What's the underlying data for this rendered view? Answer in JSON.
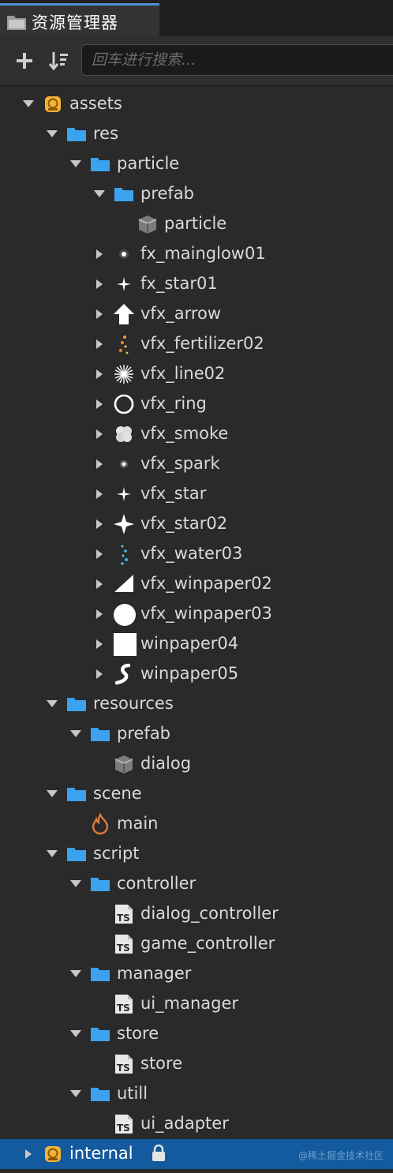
{
  "panel": {
    "title": "资源管理器"
  },
  "toolbar": {
    "search_placeholder": "回车进行搜索..."
  },
  "tree": [
    {
      "depth": 0,
      "label": "assets",
      "icon": "db-icon",
      "expanded": true
    },
    {
      "depth": 1,
      "label": "res",
      "icon": "folder-icon",
      "expanded": true
    },
    {
      "depth": 2,
      "label": "particle",
      "icon": "folder-icon",
      "expanded": true
    },
    {
      "depth": 3,
      "label": "prefab",
      "icon": "folder-icon",
      "expanded": true
    },
    {
      "depth": 4,
      "label": "particle",
      "icon": "prefab-icon"
    },
    {
      "depth": 3,
      "label": "fx_mainglow01",
      "icon": "glow-small-icon",
      "expanded": false
    },
    {
      "depth": 3,
      "label": "fx_star01",
      "icon": "star-small-icon",
      "expanded": false
    },
    {
      "depth": 3,
      "label": "vfx_arrow",
      "icon": "arrow-up-icon",
      "expanded": false
    },
    {
      "depth": 3,
      "label": "vfx_fertilizer02",
      "icon": "fertilizer-icon",
      "expanded": false
    },
    {
      "depth": 3,
      "label": "vfx_line02",
      "icon": "burst-icon",
      "expanded": false
    },
    {
      "depth": 3,
      "label": "vfx_ring",
      "icon": "ring-icon",
      "expanded": false
    },
    {
      "depth": 3,
      "label": "vfx_smoke",
      "icon": "smoke-icon",
      "expanded": false
    },
    {
      "depth": 3,
      "label": "vfx_spark",
      "icon": "spark-icon",
      "expanded": false
    },
    {
      "depth": 3,
      "label": "vfx_star",
      "icon": "star-small-icon",
      "expanded": false
    },
    {
      "depth": 3,
      "label": "vfx_star02",
      "icon": "star-large-icon",
      "expanded": false
    },
    {
      "depth": 3,
      "label": "vfx_water03",
      "icon": "water-icon",
      "expanded": false
    },
    {
      "depth": 3,
      "label": "vfx_winpaper02",
      "icon": "triangle-icon",
      "expanded": false
    },
    {
      "depth": 3,
      "label": "vfx_winpaper03",
      "icon": "circle-icon",
      "expanded": false
    },
    {
      "depth": 3,
      "label": "winpaper04",
      "icon": "square-icon",
      "expanded": false
    },
    {
      "depth": 3,
      "label": "winpaper05",
      "icon": "curl-icon",
      "expanded": false
    },
    {
      "depth": 1,
      "label": "resources",
      "icon": "folder-icon",
      "expanded": true
    },
    {
      "depth": 2,
      "label": "prefab",
      "icon": "folder-icon",
      "expanded": true
    },
    {
      "depth": 3,
      "label": "dialog",
      "icon": "prefab-icon"
    },
    {
      "depth": 1,
      "label": "scene",
      "icon": "folder-icon",
      "expanded": true
    },
    {
      "depth": 2,
      "label": "main",
      "icon": "scene-icon"
    },
    {
      "depth": 1,
      "label": "script",
      "icon": "folder-icon",
      "expanded": true
    },
    {
      "depth": 2,
      "label": "controller",
      "icon": "folder-icon",
      "expanded": true
    },
    {
      "depth": 3,
      "label": "dialog_controller",
      "icon": "ts-icon"
    },
    {
      "depth": 3,
      "label": "game_controller",
      "icon": "ts-icon"
    },
    {
      "depth": 2,
      "label": "manager",
      "icon": "folder-icon",
      "expanded": true
    },
    {
      "depth": 3,
      "label": "ui_manager",
      "icon": "ts-icon"
    },
    {
      "depth": 2,
      "label": "store",
      "icon": "folder-icon",
      "expanded": true
    },
    {
      "depth": 3,
      "label": "store",
      "icon": "ts-icon"
    },
    {
      "depth": 2,
      "label": "utill",
      "icon": "folder-icon",
      "expanded": true
    },
    {
      "depth": 3,
      "label": "ui_adapter",
      "icon": "ts-icon"
    },
    {
      "depth": 0,
      "label": "internal",
      "icon": "db-icon",
      "expanded": false,
      "selected": true,
      "locked": true
    }
  ],
  "watermark": "@稀土掘金技术社区",
  "colors": {
    "accent": "#4f8fd0",
    "selection": "#145a9e",
    "folder": "#3ba2f0",
    "db": "#f2b437",
    "scene": "#e07b39"
  }
}
